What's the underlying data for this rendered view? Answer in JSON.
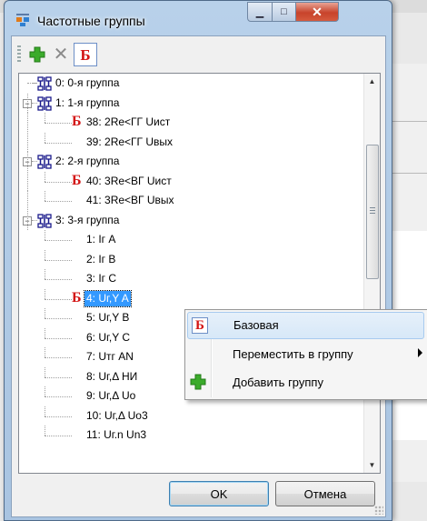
{
  "window": {
    "title": "Частотные группы"
  },
  "toolbar": {
    "base_glyph": "Б"
  },
  "tree": {
    "rows": [
      {
        "indent": 0,
        "kind": "group",
        "label": "0:  0-я группа",
        "expander": "",
        "base": false,
        "selected": false
      },
      {
        "indent": 0,
        "kind": "group",
        "label": "1:  1-я группа",
        "expander": "−",
        "base": false,
        "selected": false
      },
      {
        "indent": 1,
        "kind": "item",
        "label": "38:  2Re<ГГ Uист",
        "base": true,
        "selected": false
      },
      {
        "indent": 1,
        "kind": "item",
        "label": "39:  2Re<ГГ Uвых",
        "base": false,
        "selected": false
      },
      {
        "indent": 0,
        "kind": "group",
        "label": "2:  2-я группа",
        "expander": "−",
        "base": false,
        "selected": false
      },
      {
        "indent": 1,
        "kind": "item",
        "label": "40:  3Re<ВГ Uист",
        "base": true,
        "selected": false
      },
      {
        "indent": 1,
        "kind": "item",
        "label": "41:  3Re<ВГ Uвых",
        "base": false,
        "selected": false
      },
      {
        "indent": 0,
        "kind": "group",
        "label": "3:  3-я группа",
        "expander": "−",
        "base": false,
        "selected": false
      },
      {
        "indent": 1,
        "kind": "item",
        "label": "1:  Iг A",
        "base": false,
        "selected": false
      },
      {
        "indent": 1,
        "kind": "item",
        "label": "2:  Iг B",
        "base": false,
        "selected": false
      },
      {
        "indent": 1,
        "kind": "item",
        "label": "3:  Iг C",
        "base": false,
        "selected": false
      },
      {
        "indent": 1,
        "kind": "item",
        "label": "4:  Uг,Y A",
        "base": true,
        "selected": true
      },
      {
        "indent": 1,
        "kind": "item",
        "label": "5:  Uг,Y B",
        "base": false,
        "selected": false
      },
      {
        "indent": 1,
        "kind": "item",
        "label": "6:  Uг,Y C",
        "base": false,
        "selected": false
      },
      {
        "indent": 1,
        "kind": "item",
        "label": "7:  Uтг AN",
        "base": false,
        "selected": false
      },
      {
        "indent": 1,
        "kind": "item",
        "label": "8:  Uг,Δ HИ",
        "base": false,
        "selected": false
      },
      {
        "indent": 1,
        "kind": "item",
        "label": "9:  Uг,Δ Uo",
        "base": false,
        "selected": false
      },
      {
        "indent": 1,
        "kind": "item",
        "label": "10:  Uг,Δ Uo3",
        "base": false,
        "selected": false
      },
      {
        "indent": 1,
        "kind": "item",
        "label": "11:  Uг.n Un3",
        "base": false,
        "selected": false
      }
    ]
  },
  "buttons": {
    "ok": "OK",
    "cancel": "Отмена"
  },
  "context_menu": {
    "items": [
      {
        "label": "Базовая",
        "icon": "base-b-icon",
        "submenu": false,
        "hover": true
      },
      {
        "label": "Переместить в группу",
        "icon": "",
        "submenu": true,
        "hover": false
      },
      {
        "label": "Добавить группу",
        "icon": "green-plus-icon",
        "submenu": false,
        "hover": false
      }
    ]
  },
  "colors": {
    "base_mark": "#d31414",
    "selection": "#3399ff",
    "plus": "#3bab2b"
  }
}
